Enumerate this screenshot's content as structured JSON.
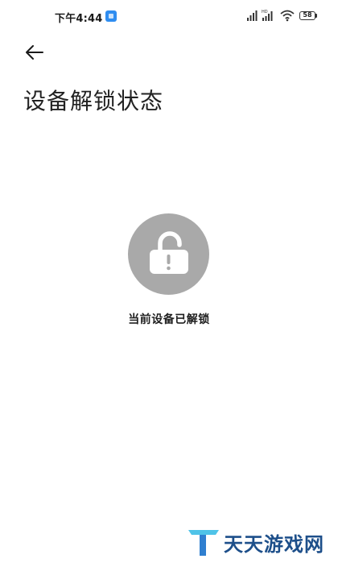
{
  "status_bar": {
    "time": "下午4:44",
    "battery": "58",
    "icons": [
      "notification-app-icon",
      "signal-icon",
      "hd-signal-icon",
      "wifi-icon",
      "battery-icon"
    ]
  },
  "header": {
    "back_icon": "back-arrow-icon",
    "title": "设备解锁状态"
  },
  "main": {
    "lock_icon": "unlocked-padlock-icon",
    "status_text": "当前设备已解锁"
  },
  "watermark": {
    "text": "天天游戏网"
  },
  "colors": {
    "background": "#ffffff",
    "lock_circle": "#a9a9a9",
    "watermark_text": "#1d4f8a"
  }
}
